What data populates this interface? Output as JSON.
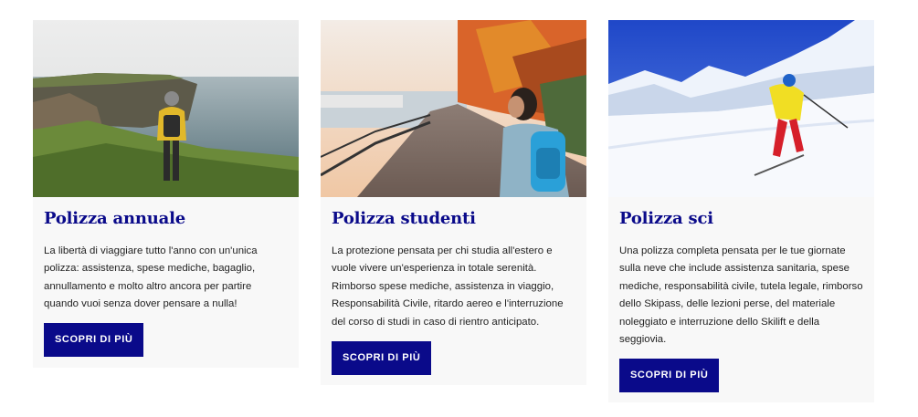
{
  "cards": [
    {
      "title": "Polizza annuale",
      "description": "La libertà di viaggiare tutto l'anno con un'unica polizza: assistenza, spese mediche, bagaglio, annullamento e molto altro ancora per partire quando vuoi senza dover pensare a nulla!",
      "cta": "SCOPRI DI PIÙ",
      "image": "traveler-on-cliff-photo"
    },
    {
      "title": "Polizza studenti",
      "description": "La protezione pensata per chi studia all'estero e vuole vivere un'esperienza in totale serenità. Rimborso spese mediche, assistenza in viaggio, Responsabilità Civile, ritardo aereo e l'interruzione del corso di studi in caso di rientro anticipato.",
      "cta": "SCOPRI DI PIÙ",
      "image": "student-with-backpack-photo"
    },
    {
      "title": "Polizza sci",
      "description": "Una polizza completa pensata per le tue giornate sulla neve che include assistenza sanitaria, spese mediche, responsabilità civile, tutela legale, rimborso dello Skipass, delle lezioni perse, del materiale noleggiato e interruzione dello Skilift e della seggiovia.",
      "cta": "SCOPRI DI PIÙ",
      "image": "skier-on-slope-photo"
    }
  ],
  "colors": {
    "brand_blue": "#0a0a8a",
    "card_background": "#f8f8f8",
    "text": "#222222"
  }
}
